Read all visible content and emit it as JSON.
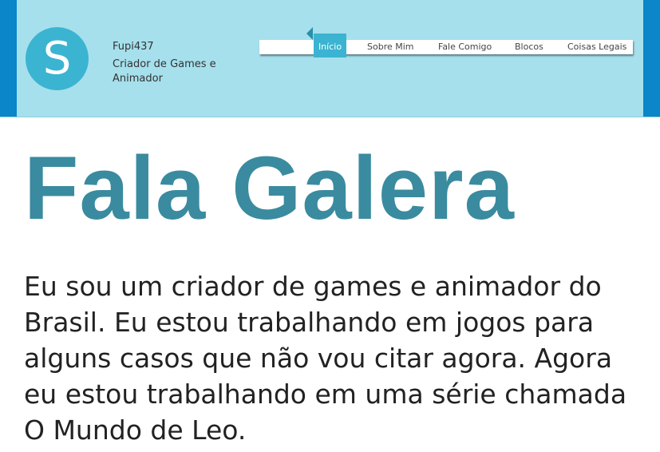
{
  "header": {
    "logo_letter": "S",
    "site_name": "Fupi437",
    "tagline": "Criador de Games e Animador",
    "accent_color": "#3bb4d1",
    "background_color": "#a6e0ec",
    "edge_color": "#0a86c9"
  },
  "nav": {
    "items": [
      {
        "label": "Início",
        "active": true
      },
      {
        "label": "Sobre Mim",
        "active": false
      },
      {
        "label": "Fale Comigo",
        "active": false
      },
      {
        "label": "Blocos",
        "active": false
      },
      {
        "label": "Coisas Legais",
        "active": false
      }
    ]
  },
  "main": {
    "heading": "Fala Galera",
    "heading_color": "#3a8b9f",
    "paragraph": "Eu sou um criador de games e animador do Brasil. Eu estou trabalhando em jogos para alguns casos que não vou citar agora. Agora eu estou trabalhando em uma série chamada O Mundo de Leo."
  }
}
